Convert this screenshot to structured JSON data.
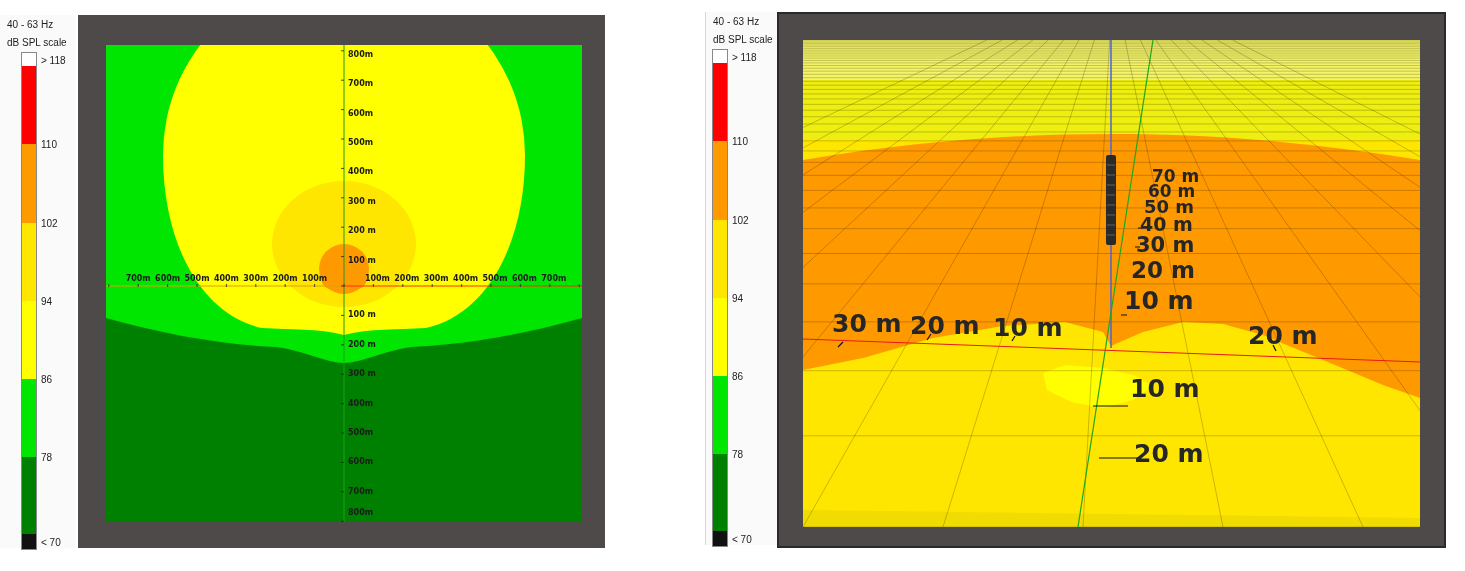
{
  "legends": [
    {
      "frequency": "40 - 63 Hz",
      "scale_title": "dB SPL scale",
      "bands": [
        {
          "color": "#ffffff",
          "label": "> 118"
        },
        {
          "color": "#ff0000"
        },
        {
          "color": "#ff9900",
          "label": "110"
        },
        {
          "color": "#ffe600",
          "label": "102"
        },
        {
          "color": "#ffff00",
          "label": "94"
        },
        {
          "color": "#00e600",
          "label": "86"
        },
        {
          "color": "#008000",
          "label": "78"
        },
        {
          "color": "#111111",
          "label": "< 70"
        }
      ]
    },
    {
      "frequency": "40 - 63 Hz",
      "scale_title": "dB SPL scale",
      "bands": [
        {
          "color": "#ffffff",
          "label": "> 118"
        },
        {
          "color": "#ff0000"
        },
        {
          "color": "#ff9900",
          "label": "110"
        },
        {
          "color": "#ffe600",
          "label": "102"
        },
        {
          "color": "#ffff00",
          "label": "94"
        },
        {
          "color": "#00e600",
          "label": "86"
        },
        {
          "color": "#008000",
          "label": "78"
        },
        {
          "color": "#111111",
          "label": "< 70"
        }
      ]
    }
  ],
  "plan_view": {
    "x_axis_left": [
      "700m",
      "600m",
      "500m",
      "400m",
      "300m",
      "200m",
      "100m"
    ],
    "x_axis_right": [
      "100m",
      "200m",
      "300m",
      "400m",
      "500m",
      "600m",
      "700m"
    ],
    "y_axis_up": [
      "800m",
      "700m",
      "600m",
      "500m",
      "400m",
      "300 m",
      "200 m",
      "100 m"
    ],
    "y_axis_down": [
      "100 m",
      "200 m",
      "300 m",
      "400m",
      "500m",
      "600m",
      "700m",
      "800m"
    ]
  },
  "perspective_view": {
    "height_axis": [
      "70 m",
      "60 m",
      "50 m",
      "40 m",
      "30 m",
      "20 m",
      "10 m"
    ],
    "left_axis": [
      "30 m",
      "20 m",
      "10 m"
    ],
    "right_axis": [
      "20 m"
    ],
    "depth_axis": [
      "10 m",
      "20 m"
    ]
  }
}
